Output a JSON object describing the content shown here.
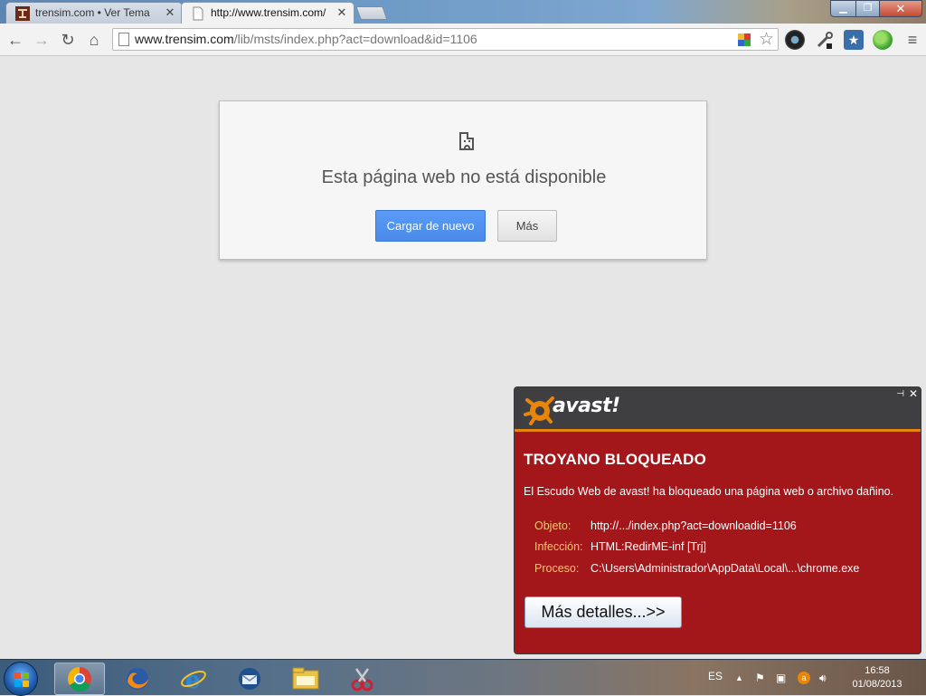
{
  "browser": {
    "tabs": [
      {
        "title": "trensim.com • Ver Tema - ",
        "active": false,
        "icon": "trensim-favicon-icon"
      },
      {
        "title": "http://www.trensim.com/",
        "active": true,
        "icon": "page-icon"
      }
    ],
    "window_controls": {
      "minimize": "▁",
      "maximize": "❐",
      "close": "✕"
    },
    "toolbar": {
      "back": "←",
      "forward": "→",
      "reload": "↻",
      "home": "⌂",
      "menu": "≡"
    },
    "address_bar": {
      "host": "www.trensim.com",
      "path": "/lib/msts/index.php?act=download&id=1106"
    }
  },
  "error_page": {
    "title": "Esta página web no está disponible",
    "reload_button": "Cargar de nuevo",
    "more_button": "Más"
  },
  "avast_popup": {
    "brand": "avast!",
    "pin_icon": "pin-icon",
    "close_glyph": "✕",
    "heading": "TROYANO BLOQUEADO",
    "message": "El Escudo Web de avast! ha bloqueado una página web o archivo dañino.",
    "details": [
      {
        "label": "Objeto:",
        "value": "http://.../index.php?act=downloadid=1106"
      },
      {
        "label": "Infección:",
        "value": "HTML:RedirME-inf [Trj]"
      },
      {
        "label": "Proceso:",
        "value": "C:\\Users\\Administrador\\AppData\\Local\\...\\chrome.exe"
      }
    ],
    "details_button": "Más detalles...>>",
    "colors": {
      "background": "#a3161a",
      "header": "#3f3f41",
      "accent": "#e8860b",
      "label": "#f7c872"
    }
  },
  "taskbar": {
    "apps": [
      "chrome-icon",
      "firefox-icon",
      "internet-explorer-icon",
      "thunderbird-icon",
      "file-explorer-icon",
      "snipping-tool-icon"
    ],
    "language": "ES",
    "tray_expand": "▲",
    "time": "16:58",
    "date": "01/08/2013"
  }
}
